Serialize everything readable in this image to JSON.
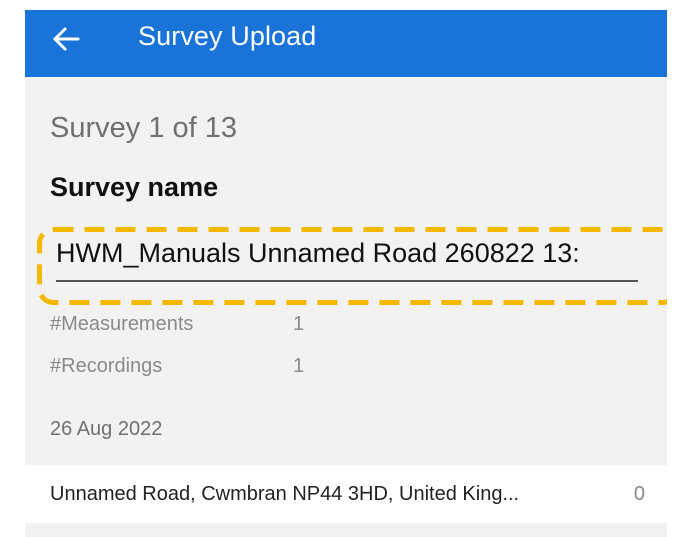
{
  "header": {
    "title": "Survey Upload",
    "back_icon": "arrow-left-icon"
  },
  "survey": {
    "counter": "Survey 1 of 13",
    "name_label": "Survey name",
    "name_value": "HWM_Manuals Unnamed Road 260822 13:",
    "measurements_label": "#Measurements",
    "measurements_value": "1",
    "recordings_label": "#Recordings",
    "recordings_value": "1",
    "date": "26 Aug 2022"
  },
  "recordings_list": [
    {
      "location": "Unnamed Road, Cwmbran NP44 3HD, United King...",
      "count": "0"
    }
  ],
  "colors": {
    "appbar": "#1a73d9",
    "highlight": "#f5b800",
    "background": "#f2f2f2"
  }
}
